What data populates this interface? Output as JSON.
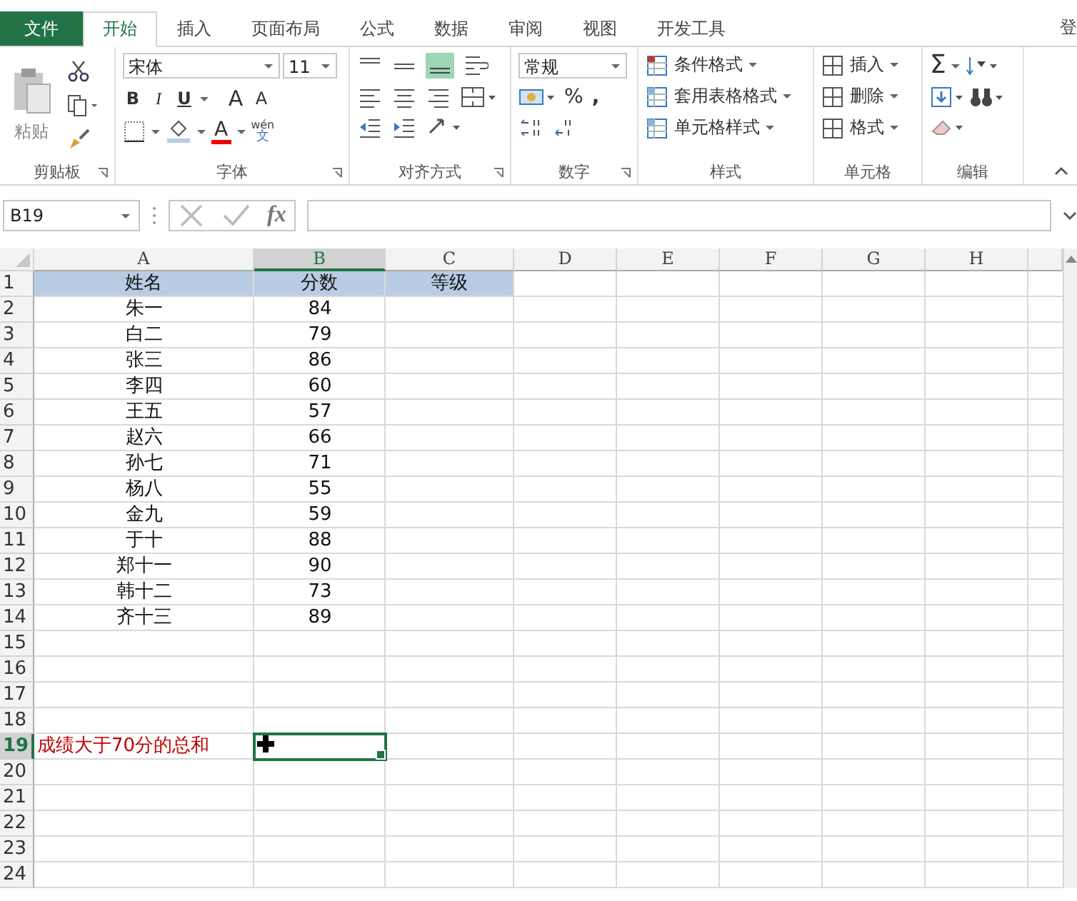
{
  "tabs": [
    {
      "label": "文件",
      "kind": "file",
      "selected": false
    },
    {
      "label": "开始",
      "kind": "tab",
      "selected": true
    },
    {
      "label": "插入",
      "kind": "tab",
      "selected": false
    },
    {
      "label": "页面布局",
      "kind": "tab",
      "selected": false
    },
    {
      "label": "公式",
      "kind": "tab",
      "selected": false
    },
    {
      "label": "数据",
      "kind": "tab",
      "selected": false
    },
    {
      "label": "审阅",
      "kind": "tab",
      "selected": false
    },
    {
      "label": "视图",
      "kind": "tab",
      "selected": false
    },
    {
      "label": "开发工具",
      "kind": "tab",
      "selected": false
    }
  ],
  "account": "登",
  "ribbon": {
    "clipboard": {
      "paste": "粘贴",
      "label": "剪贴板"
    },
    "font": {
      "name": "宋体",
      "size": "11",
      "bold": "B",
      "italic": "I",
      "underline": "U",
      "grow": "A",
      "shrink": "A",
      "font_color": "A",
      "phonetic_top": "wén",
      "phonetic_bottom": "文",
      "label": "字体"
    },
    "alignment": {
      "label": "对齐方式"
    },
    "number": {
      "format": "常规",
      "percent": "%",
      "comma": ",",
      "label": "数字"
    },
    "styles": {
      "items": [
        "条件格式",
        "套用表格格式",
        "单元格样式"
      ],
      "label": "样式"
    },
    "cells": {
      "items": [
        "插入",
        "删除",
        "格式"
      ],
      "label": "单元格"
    },
    "editing": {
      "sum": "Σ",
      "label": "编辑"
    }
  },
  "formula_bar": {
    "name_box": "B19",
    "function_label": "fx"
  },
  "sheet": {
    "columns": [
      {
        "label": "A",
        "selected": false
      },
      {
        "label": "B",
        "selected": true
      },
      {
        "label": "C",
        "selected": false
      },
      {
        "label": "D",
        "selected": false
      },
      {
        "label": "E",
        "selected": false
      },
      {
        "label": "F",
        "selected": false
      },
      {
        "label": "G",
        "selected": false
      },
      {
        "label": "H",
        "selected": false
      }
    ],
    "rows": [
      {
        "number": "1",
        "kind": "header",
        "selected": false,
        "cells": [
          "姓名",
          "分数",
          "等级"
        ]
      },
      {
        "number": "2",
        "kind": "data",
        "selected": false,
        "cells": [
          "朱一",
          "84"
        ]
      },
      {
        "number": "3",
        "kind": "data",
        "selected": false,
        "cells": [
          "白二",
          "79"
        ]
      },
      {
        "number": "4",
        "kind": "data",
        "selected": false,
        "cells": [
          "张三",
          "86"
        ]
      },
      {
        "number": "5",
        "kind": "data",
        "selected": false,
        "cells": [
          "李四",
          "60"
        ]
      },
      {
        "number": "6",
        "kind": "data",
        "selected": false,
        "cells": [
          "王五",
          "57"
        ]
      },
      {
        "number": "7",
        "kind": "data",
        "selected": false,
        "cells": [
          "赵六",
          "66"
        ]
      },
      {
        "number": "8",
        "kind": "data",
        "selected": false,
        "cells": [
          "孙七",
          "71"
        ]
      },
      {
        "number": "9",
        "kind": "data",
        "selected": false,
        "cells": [
          "杨八",
          "55"
        ]
      },
      {
        "number": "10",
        "kind": "data",
        "selected": false,
        "cells": [
          "金九",
          "59"
        ]
      },
      {
        "number": "11",
        "kind": "data",
        "selected": false,
        "cells": [
          "于十",
          "88"
        ]
      },
      {
        "number": "12",
        "kind": "data",
        "selected": false,
        "cells": [
          "郑十一",
          "90"
        ]
      },
      {
        "number": "13",
        "kind": "data",
        "selected": false,
        "cells": [
          "韩十二",
          "73"
        ]
      },
      {
        "number": "14",
        "kind": "data",
        "selected": false,
        "cells": [
          "齐十三",
          "89"
        ]
      },
      {
        "number": "15",
        "kind": "data",
        "selected": false,
        "cells": []
      },
      {
        "number": "16",
        "kind": "data",
        "selected": false,
        "cells": []
      },
      {
        "number": "17",
        "kind": "data",
        "selected": false,
        "cells": []
      },
      {
        "number": "18",
        "kind": "data",
        "selected": false,
        "cells": []
      },
      {
        "number": "19",
        "kind": "note",
        "selected": true,
        "cells": [
          "成绩大于70分的总和"
        ]
      },
      {
        "number": "20",
        "kind": "data",
        "selected": false,
        "cells": []
      },
      {
        "number": "21",
        "kind": "data",
        "selected": false,
        "cells": []
      },
      {
        "number": "22",
        "kind": "data",
        "selected": false,
        "cells": []
      },
      {
        "number": "23",
        "kind": "data",
        "selected": false,
        "cells": []
      },
      {
        "number": "24",
        "kind": "data",
        "selected": false,
        "cells": []
      }
    ]
  }
}
